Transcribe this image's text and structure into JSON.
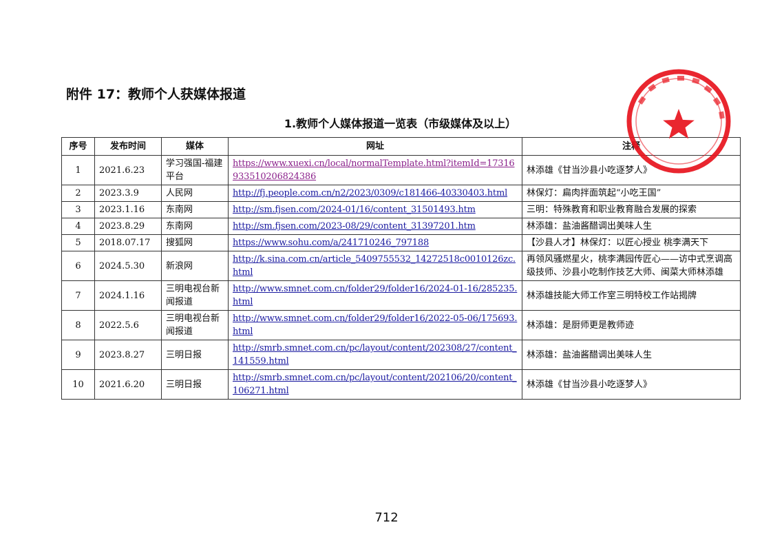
{
  "heading": "附件 17：教师个人获媒体报道",
  "subheading": "1.教师个人媒体报道一览表（市级媒体及以上）",
  "table": {
    "headers": [
      "序号",
      "发布时间",
      "媒体",
      "网址",
      "注释"
    ],
    "rows": [
      {
        "idx": "1",
        "date": "2021.6.23",
        "media": "学习强国-福建平台",
        "url": "https://www.xuexi.cn/local/normalTemplate.html?itemId=17316933510206824386",
        "note": "林添雄《甘当沙县小吃逐梦人》",
        "visited": true
      },
      {
        "idx": "2",
        "date": "2023.3.9",
        "media": "人民网",
        "url": "http://fj.people.com.cn/n2/2023/0309/c181466-40330403.html",
        "note": "林保灯：扁肉拌面筑起“小吃王国”",
        "visited": false
      },
      {
        "idx": "3",
        "date": "2023.1.16",
        "media": "东南网",
        "url": "http://sm.fjsen.com/2024-01/16/content_31501493.htm",
        "note": "三明：特殊教育和职业教育融合发展的探索",
        "visited": false
      },
      {
        "idx": "4",
        "date": "2023.8.29",
        "media": "东南网",
        "url": "http://sm.fjsen.com/2023-08/29/content_31397201.htm",
        "note": "林添雄：盐油酱醋调出美味人生",
        "visited": false
      },
      {
        "idx": "5",
        "date": "2018.07.17",
        "media": "搜狐网",
        "url": "https://www.sohu.com/a/241710246_797188",
        "note": "【沙县人才】林保灯：以匠心授业 桃李满天下",
        "visited": false
      },
      {
        "idx": "6",
        "date": "2024.5.30",
        "media": "新浪网",
        "url": "http://k.sina.com.cn/article_5409755532_14272518c0010126zc.html",
        "note": "再领风骚燃星火，桃李满园传匠心——访中式烹调高级技师、沙县小吃制作技艺大师、闽菜大师林添雄",
        "visited": false
      },
      {
        "idx": "7",
        "date": "2024.1.16",
        "media": "三明电视台新闻报道",
        "url": "http://www.smnet.com.cn/folder29/folder16/2024-01-16/285235.html",
        "note": "林添雄技能大师工作室三明特校工作站揭牌",
        "visited": false
      },
      {
        "idx": "8",
        "date": "2022.5.6",
        "media": "三明电视台新闻报道",
        "url": "http://www.smnet.com.cn/folder29/folder16/2022-05-06/175693.html",
        "note": "林添雄：是厨师更是教师迹",
        "visited": false
      },
      {
        "idx": "9",
        "date": "2023.8.27",
        "media": "三明日报",
        "url": "http://smrb.smnet.com.cn/pc/layout/content/202308/27/content_141559.html",
        "note": "林添雄：盐油酱醋调出美味人生",
        "visited": false
      },
      {
        "idx": "10",
        "date": "2021.6.20",
        "media": "三明日报",
        "url": "http://smrb.smnet.com.cn/pc/layout/content/202106/20/content_106271.html",
        "note": "林添雄《甘当沙县小吃逐梦人》",
        "visited": false
      }
    ]
  },
  "seal": {
    "icon": "red-star-seal-icon",
    "color": "#e8141e"
  },
  "page_number": "712"
}
